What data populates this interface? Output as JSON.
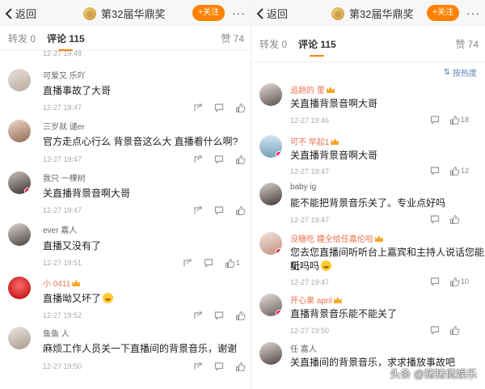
{
  "left": {
    "nav": {
      "back_label": "返回",
      "title": "第32届华鼎奖",
      "follow_label": "+关注",
      "more_label": "···"
    },
    "tabs": {
      "repost": "转发 0",
      "comments": "评论 115",
      "likes": "赞 74"
    },
    "top_partial": {
      "time": "12-27 19:48"
    },
    "comments": [
      {
        "user": "可爱又    乐吖",
        "user_color": "normal",
        "text": "直播事故了大哥",
        "time": "12-27 19:47",
        "likes": ""
      },
      {
        "user": "三岁就    谴er",
        "user_color": "normal",
        "text": "官方走点心行么  背景音这么大  直播看什么啊?",
        "time": "12-27 19:47",
        "likes": ""
      },
      {
        "user": "我只      一棵树",
        "user_color": "normal",
        "text": "关直播背景音啊大哥",
        "time": "12-27 19:47",
        "likes": ""
      },
      {
        "user": "    ever 嘉人",
        "user_color": "normal",
        "text": "直播又没有了",
        "time": "12-27 19:51",
        "likes": "1"
      },
      {
        "user": "小        0411",
        "user_color": "orange",
        "text": "直播呦又坏了",
        "time": "12-27 19:52",
        "likes": ""
      },
      {
        "user": "鱼鱼      人",
        "user_color": "normal",
        "text": "麻烦工作人员关一下直播间的背景音乐，谢谢",
        "time": "12-27 19:50",
        "likes": ""
      }
    ]
  },
  "right": {
    "nav": {
      "back_label": "返回",
      "title": "第32届华鼎奖",
      "follow_label": "+关注",
      "more_label": "···"
    },
    "tabs": {
      "repost": "转发 0",
      "comments": "评论 115",
      "likes": "赞 74"
    },
    "sort_label": "按热度",
    "comments": [
      {
        "user": "追趟的        里",
        "user_color": "orange",
        "text": "关直播背景音啊大哥",
        "time": "12-27 19:46",
        "likes": "18"
      },
      {
        "user": "可不        早起1",
        "user_color": "orange",
        "text": "关直播背景音啊大哥",
        "time": "12-27 19:47",
        "likes": "12"
      },
      {
        "user": "baby     ig",
        "user_color": "normal",
        "text": "能不能把背景音乐关了。专业点好吗",
        "time": "12-27 19:47",
        "likes": ""
      },
      {
        "user": "没糖吃       嫤全给任嘉伦啦",
        "user_color": "orange",
        "text_line1": "您去您直播间听听台上嘉宾和主持人说话您能听",
        "text_line2": "见吗吗",
        "time": "12-27 19:47",
        "likes": "10"
      },
      {
        "user": "开心果         april",
        "user_color": "orange",
        "text": "直播背景音乐能不能关了",
        "time": "12-27 19:50",
        "likes": ""
      },
      {
        "user": "任         嘉人",
        "user_color": "normal",
        "text": "关直播间的背景音乐，求求播放事故吧",
        "time": "",
        "likes": ""
      }
    ],
    "watermark": "头条 @猪猪侃娱乐"
  },
  "colors": {
    "accent": "#ff8200",
    "link": "#5b7fb5",
    "orange_name": "#eb7350"
  },
  "icons": [
    "back-arrow-icon",
    "repost-icon",
    "comment-icon",
    "thumb-up-icon",
    "crown-icon",
    "sort-icon"
  ]
}
